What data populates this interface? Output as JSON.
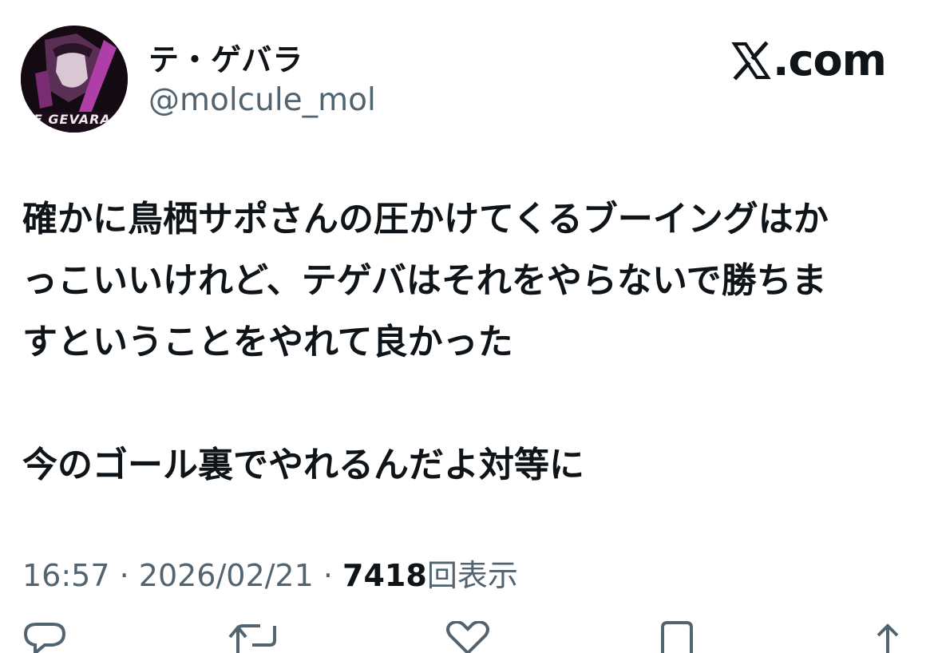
{
  "user": {
    "display_name": "テ・ゲバラ",
    "handle": "@molcule_mol",
    "avatar_caption": "TE GEVARA"
  },
  "brand": {
    "text": ".com",
    "icon": "x-logo-icon"
  },
  "tweet": {
    "lines": [
      "確かに鳥栖サポさんの圧かけてくるブーイングはか",
      "っこいいけれど、テゲバはそれをやらないで勝ちま",
      "すということをやれて良かった",
      "今のゴール裏でやれるんだよ対等に"
    ]
  },
  "meta": {
    "time": "16:57",
    "separator": " · ",
    "date": "2026/02/21",
    "views_count": "7418",
    "views_label": "回表示"
  },
  "actions": {
    "reply": {
      "icon": "reply-icon"
    },
    "repost": {
      "icon": "repost-icon"
    },
    "like": {
      "icon": "like-icon"
    },
    "bookmark": {
      "icon": "bookmark-icon"
    },
    "share": {
      "icon": "share-icon"
    }
  },
  "colors": {
    "text": "#0f1419",
    "secondary": "#536471",
    "avatar_accent": "#b03ea8"
  }
}
